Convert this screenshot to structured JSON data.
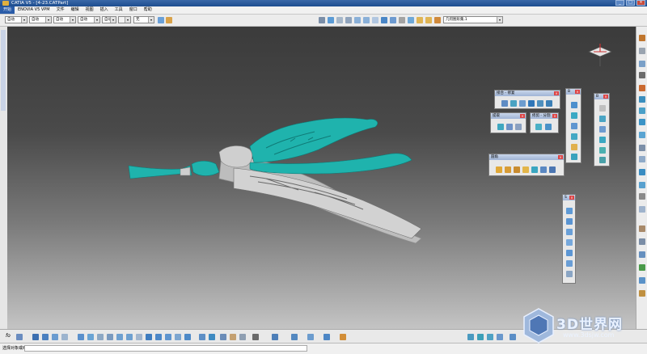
{
  "window": {
    "title": "CATIA V5 - [4-23.CATPart]"
  },
  "menu": [
    "开始",
    "ENOVIA V5 VPM",
    "文件",
    "编辑",
    "视图",
    "插入",
    "工具",
    "窗口",
    "帮助"
  ],
  "toolbar": {
    "dropdowns": [
      "自动",
      "自动",
      "自动",
      "自动",
      "自动",
      "无"
    ],
    "geo_set_dropdown": "几何图形集.1"
  },
  "palettes": {
    "surfaces": {
      "title": "接合 - 修复"
    },
    "extract": {
      "title": "提取"
    },
    "transform": {
      "title": "修剪 - 分割"
    },
    "fillet": {
      "title": "圆角"
    },
    "mini1": {
      "title": "B"
    },
    "mini2": {
      "title": "B"
    },
    "mini3": {
      "title": "S"
    }
  },
  "bottom": {
    "fx_label": "fo"
  },
  "status": {
    "text": "选择对象或命令"
  },
  "watermark": {
    "brand": "3D世界网",
    "site": "www.3dsjw.com"
  },
  "colors": {
    "accent_teal": "#1fb3ad",
    "model_gray": "#c9c9c9",
    "title_blue": "#1d4d8f"
  }
}
